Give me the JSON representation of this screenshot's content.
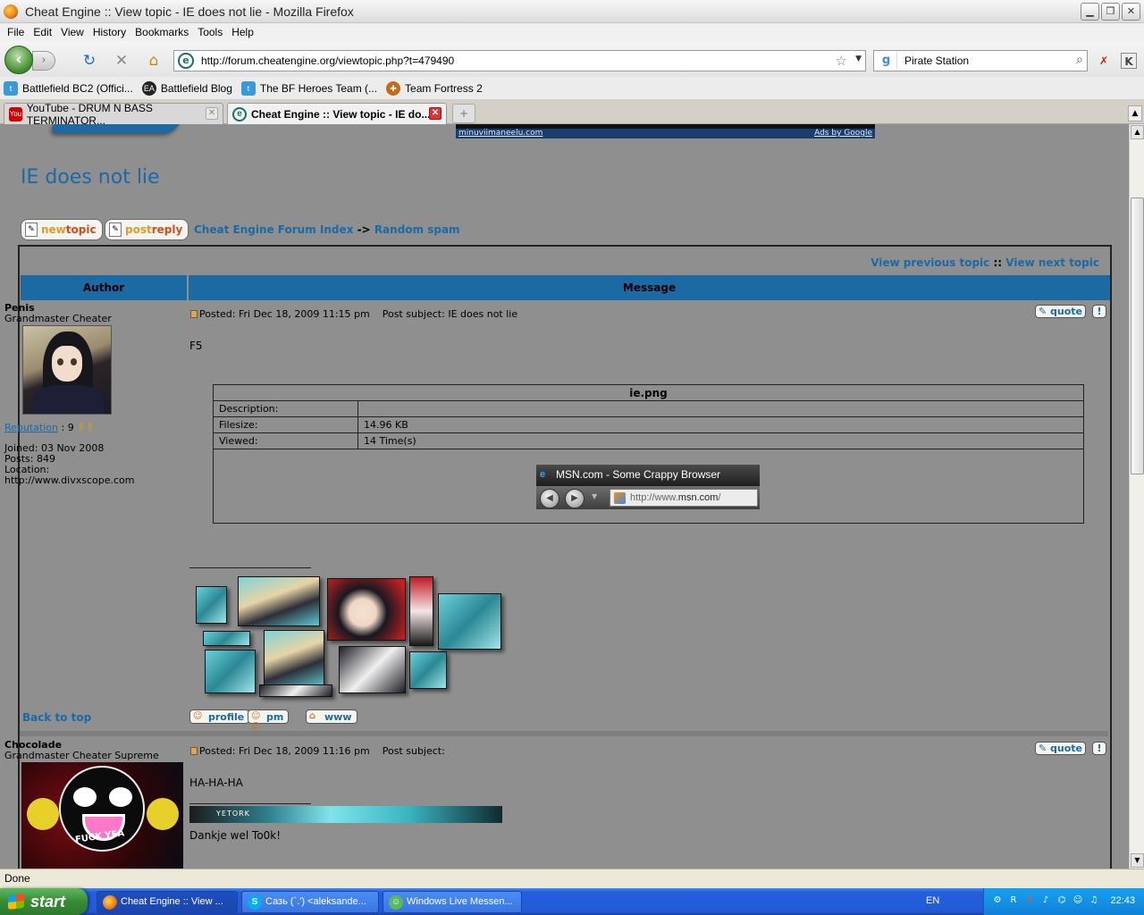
{
  "window": {
    "title": "Cheat Engine :: View topic - IE does not lie - Mozilla Firefox",
    "minimize": "▁",
    "restore": "❐",
    "close": "✕"
  },
  "menu": [
    "File",
    "Edit",
    "View",
    "History",
    "Bookmarks",
    "Tools",
    "Help"
  ],
  "nav": {
    "url": "http://forum.cheatengine.org/viewtopic.php?t=479490",
    "search_engine": "g",
    "search_text": "Pirate Station"
  },
  "bookmarks": [
    {
      "label": "Battlefield BC2 (Offici...",
      "icon": "bird-icon",
      "color": "#3a9ad9"
    },
    {
      "label": "Battlefield Blog",
      "icon": "ea-icon",
      "color": "#222222"
    },
    {
      "label": "The BF Heroes Team (...",
      "icon": "bird-icon",
      "color": "#3a9ad9"
    },
    {
      "label": "Team Fortress 2",
      "icon": "tf2-icon",
      "color": "#c76a1a"
    }
  ],
  "tabs": [
    {
      "label": "YouTube - DRUM N BASS TERMINATOR...",
      "icon": "youtube-icon",
      "active": false
    },
    {
      "label": "Cheat Engine :: View topic - IE do...",
      "icon": "cheat-engine-icon",
      "active": true
    }
  ],
  "page": {
    "ad_left": "minuviimaneelu.com",
    "ad_right": "Ads by Google",
    "topic_title": "IE does not lie",
    "new_topic": {
      "w1": "new",
      "w2": "topic"
    },
    "post_reply": {
      "w1": "post",
      "w2": "reply"
    },
    "breadcrumb": {
      "index": "Cheat Engine Forum Index",
      "sep": "->",
      "forum": "Random spam"
    },
    "nav_prev": "View previous topic",
    "nav_sep": "::",
    "nav_next": "View next topic",
    "col_author": "Author",
    "col_message": "Message",
    "back_to_top": "Back to top"
  },
  "posts": [
    {
      "author": "Penis",
      "rank": "Grandmaster Cheater",
      "reputation_label": "Reputation",
      "reputation_value": ": 9",
      "joined": "Joined: 03 Nov 2008",
      "posts": "Posts: 849",
      "location_label": "Location:",
      "location": "http://www.divxscope.com",
      "posted": "Posted: Fri Dec 18, 2009 11:15 pm",
      "subject": "Post subject: IE does not lie",
      "quote": "quote",
      "flag": "!",
      "body": "F5",
      "attachment": {
        "name": "ie.png",
        "description_label": "Description:",
        "description": "",
        "filesize_label": "Filesize:",
        "filesize": "14.96 KB",
        "viewed_label": "Viewed:",
        "viewed": "14 Time(s)",
        "image_title": "MSN.com - Some Crappy Browser",
        "image_url_prefix": "http://www.",
        "image_url_domain": "msn.com",
        "image_url_suffix": "/"
      },
      "profile": "profile",
      "pm": "pm",
      "www": "www"
    },
    {
      "author": "Chocolade",
      "rank": "Grandmaster Cheater Supreme",
      "posted": "Posted: Fri Dec 18, 2009 11:16 pm",
      "subject": "Post subject:",
      "quote": "quote",
      "flag": "!",
      "body": "HA-HA-HA",
      "sig_banner_text": "YETORK",
      "signature": "Dankje wel To0k!",
      "avatar_text": "FUCK YEA"
    }
  ],
  "status": "Done",
  "taskbar": {
    "start": "start",
    "tasks": [
      {
        "label": "Cheat Engine :: View ...",
        "icon": "firefox-icon",
        "active": true
      },
      {
        "label": "Сазь (`.') <aleksande...",
        "icon": "skype-icon",
        "active": false
      },
      {
        "label": "Windows Live Messen...",
        "icon": "messenger-icon",
        "active": false
      }
    ],
    "lang": "EN",
    "clock": "22:43"
  }
}
